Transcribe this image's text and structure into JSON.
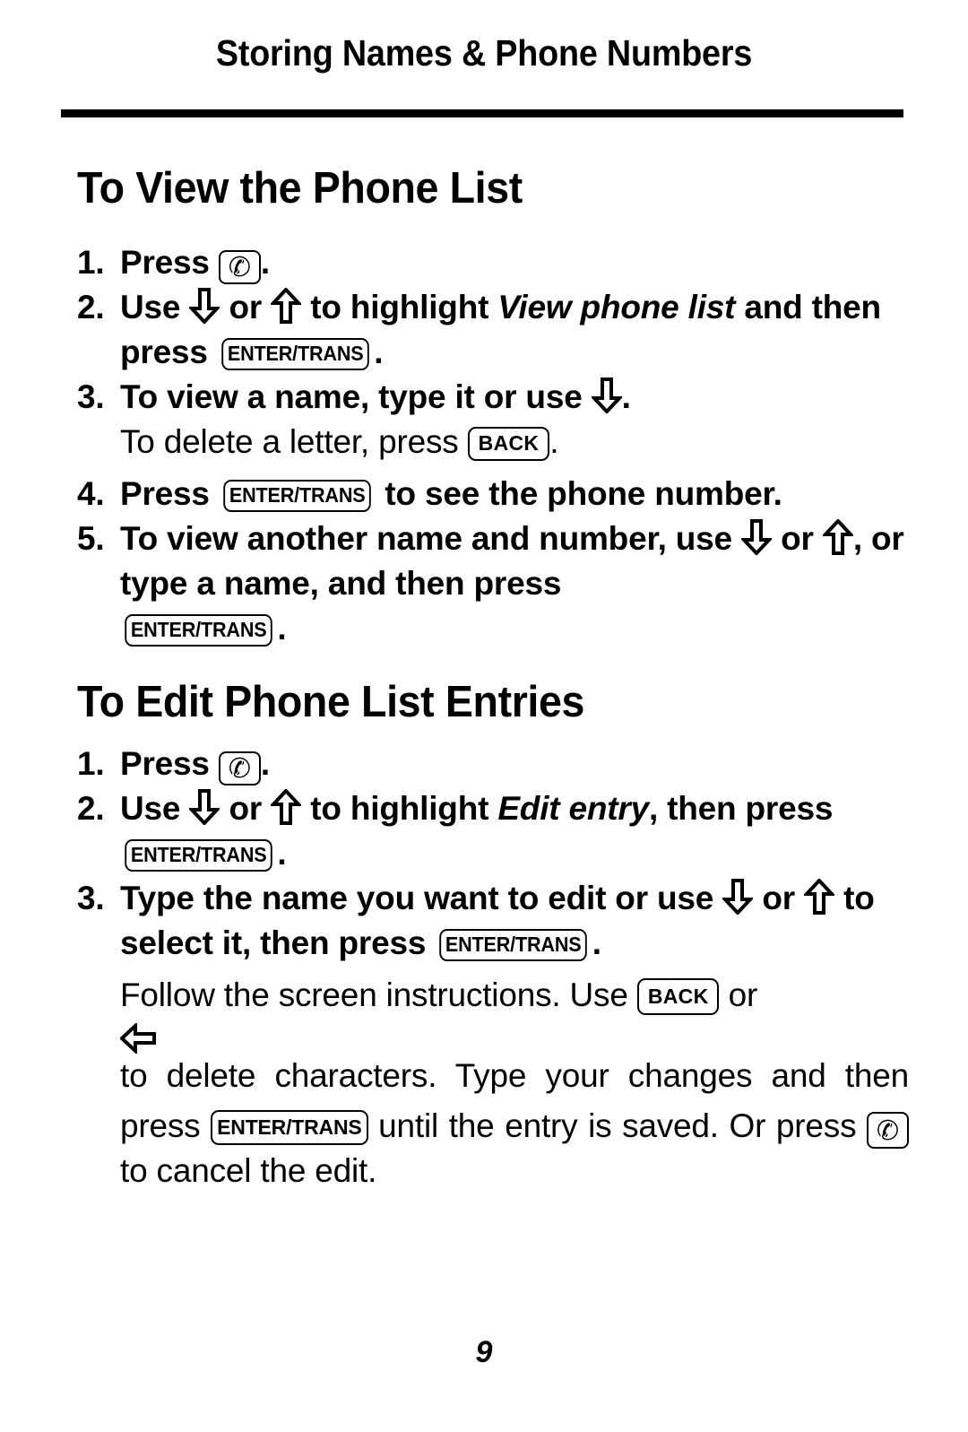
{
  "running_head": "Storing Names & Phone Numbers",
  "sections": [
    {
      "heading": "To View the Phone List",
      "steps": [
        {
          "num": "1.",
          "before": "Press",
          "after": "."
        },
        {
          "num": "2.",
          "t1": "Use",
          "t2": "or",
          "t3": "to highlight",
          "em": "View phone list",
          "t4": "and then press",
          "t5": "."
        },
        {
          "num": "3.",
          "t1": "To view a name, type it or use",
          "t2": ".",
          "sub1": "To delete a letter, press",
          "sub2": "."
        },
        {
          "num": "4.",
          "t1": "Press",
          "t2": "to see the phone number."
        },
        {
          "num": "5.",
          "t1": "To view another name and number, use",
          "t2": "or",
          "t3": ", or type a name, and then press",
          "t4": "."
        }
      ]
    },
    {
      "heading": "To Edit Phone List Entries",
      "steps": [
        {
          "num": "1.",
          "before": "Press",
          "after": "."
        },
        {
          "num": "2.",
          "t1": "Use",
          "t2": "or",
          "t3": "to highlight",
          "em": "Edit entry",
          "t4": ", then press",
          "t5": "."
        },
        {
          "num": "3.",
          "t1": "Type the name you want to edit or use",
          "t2": "or",
          "t3": "to select it, then press",
          "t4": "."
        }
      ]
    }
  ],
  "closing": {
    "p1": "Follow the screen instructions. Use",
    "p2": "or",
    "p3": "to delete characters. Type your changes and then press",
    "p4": "until the entry is saved. Or press",
    "p5": "to cancel the edit."
  },
  "keys": {
    "enter_trans": "ENTER/TRANS",
    "back": "BACK",
    "phone_glyph": "✆"
  },
  "icons": {
    "arrow_down": "arrow-down-hollow-icon",
    "arrow_up": "arrow-up-hollow-icon",
    "arrow_left": "arrow-left-hollow-icon",
    "phone": "phone-handset-icon"
  },
  "folio": "9"
}
